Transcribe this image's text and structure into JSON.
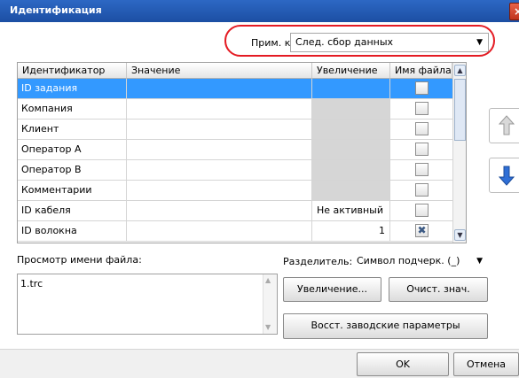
{
  "window": {
    "title": "Идентификация",
    "close_glyph": "×"
  },
  "apply_to": {
    "label": "Прим. к:",
    "value": "След. сбор данных"
  },
  "table": {
    "headers": [
      "Идентификатор",
      "Значение",
      "Увеличение",
      "Имя файла"
    ],
    "rows": [
      {
        "id": "ID задания",
        "value": "",
        "increment": "",
        "filename_checked": false,
        "selected": true
      },
      {
        "id": "Компания",
        "value": "",
        "increment": "",
        "filename_checked": false
      },
      {
        "id": "Клиент",
        "value": "",
        "increment": "",
        "filename_checked": false
      },
      {
        "id": "Оператор A",
        "value": "",
        "increment": "",
        "filename_checked": false
      },
      {
        "id": "Оператор B",
        "value": "",
        "increment": "",
        "filename_checked": false
      },
      {
        "id": "Комментарии",
        "value": "",
        "increment": "",
        "filename_checked": false
      },
      {
        "id": "ID кабеля",
        "value": "",
        "increment": "Не активный",
        "filename_checked": false
      },
      {
        "id": "ID волокна",
        "value": "",
        "increment": "1",
        "filename_checked": true
      }
    ]
  },
  "preview": {
    "label": "Просмотр имени файла:",
    "text": "1.trc"
  },
  "separator": {
    "label": "Разделитель:",
    "value": "Символ подчерк. (_)"
  },
  "buttons": {
    "increment": "Увеличение...",
    "clear_values": "Очист. знач.",
    "restore_defaults": "Восст. заводские параметры",
    "ok": "OK",
    "cancel": "Отмена"
  },
  "icons": {
    "move_up": "arrow-up-icon",
    "move_down": "arrow-down-icon",
    "dropdown": "chevron-down-icon",
    "checked_mark": "✖"
  },
  "colors": {
    "titlebar": "#1c4fa3",
    "selection": "#3399ff",
    "highlight_oval": "#e41b23",
    "arrow_blue": "#2f6fd6"
  }
}
